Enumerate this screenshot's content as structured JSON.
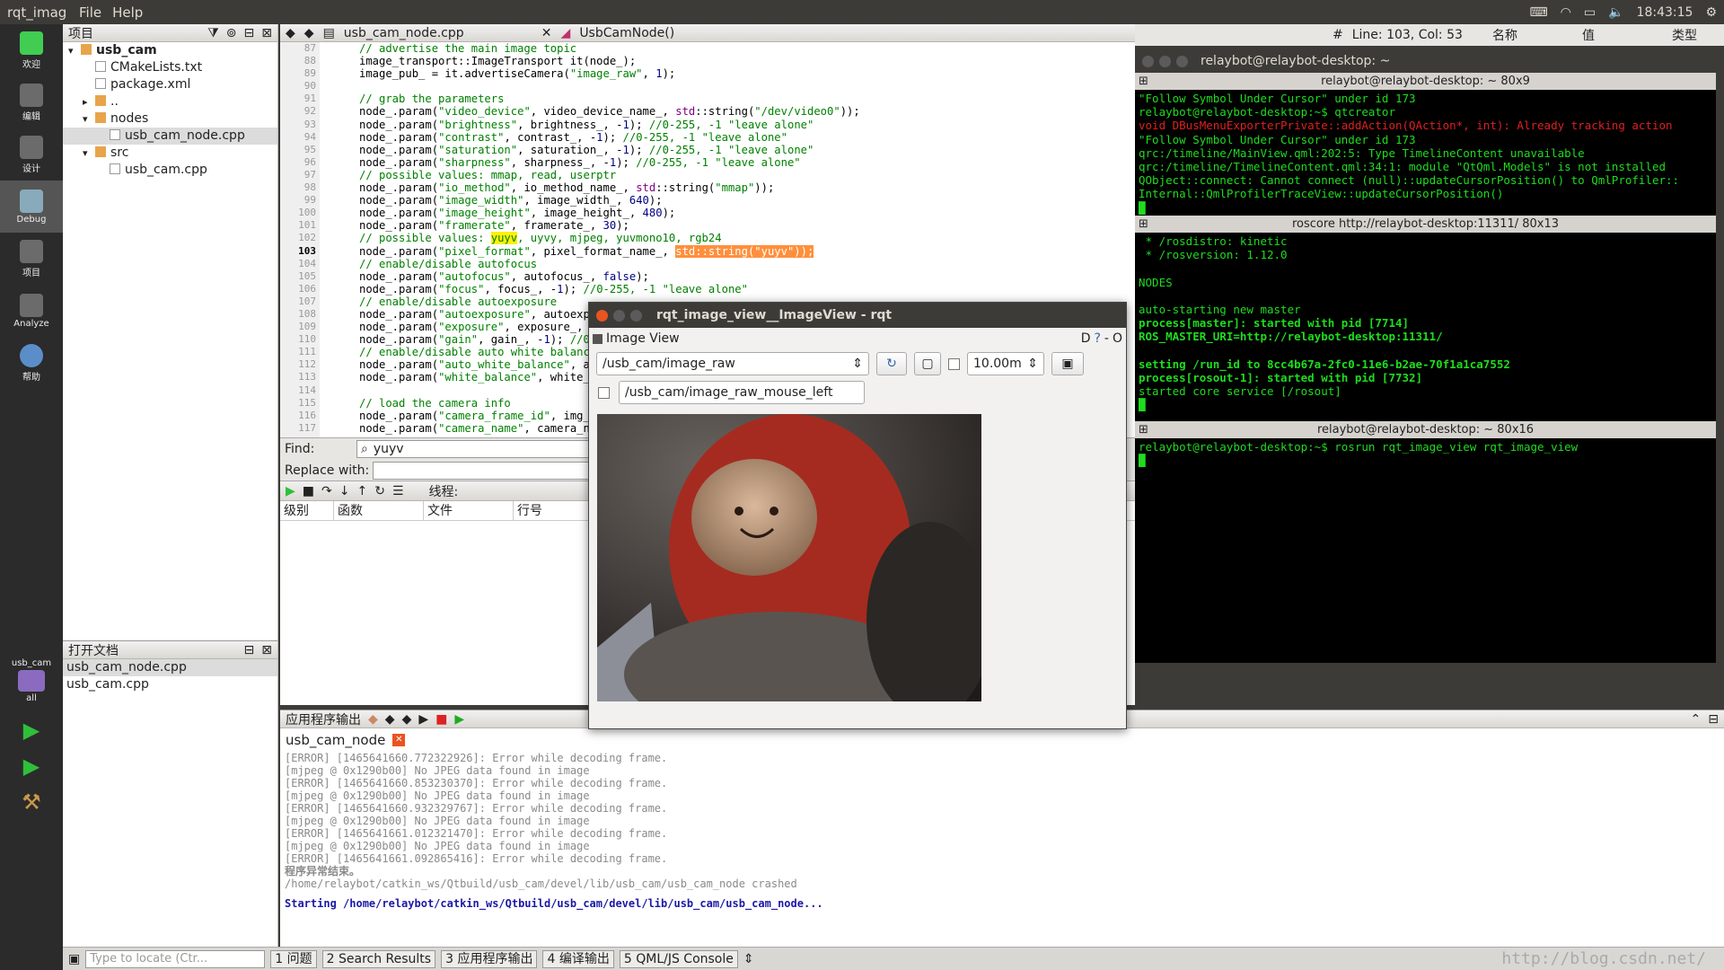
{
  "topbar": {
    "app_name": "rqt_imag",
    "menus": [
      "File",
      "Help"
    ],
    "clock": "18:43:15"
  },
  "modes": [
    {
      "label": "欢迎",
      "icon": "qt-logo-icon"
    },
    {
      "label": "编辑",
      "icon": "edit-icon"
    },
    {
      "label": "设计",
      "icon": "design-icon"
    },
    {
      "label": "Debug",
      "icon": "debug-icon"
    },
    {
      "label": "项目",
      "icon": "project-icon"
    },
    {
      "label": "Analyze",
      "icon": "analyze-icon"
    },
    {
      "label": "帮助",
      "icon": "help-icon"
    }
  ],
  "kit": {
    "project": "usb_cam",
    "config": "all"
  },
  "project_panel": {
    "title": "项目",
    "tree": [
      {
        "label": "usb_cam",
        "depth": 0,
        "kind": "project"
      },
      {
        "label": "CMakeLists.txt",
        "depth": 1,
        "kind": "file"
      },
      {
        "label": "package.xml",
        "depth": 1,
        "kind": "file"
      },
      {
        "label": "..",
        "depth": 1,
        "kind": "folder"
      },
      {
        "label": "nodes",
        "depth": 1,
        "kind": "folder"
      },
      {
        "label": "usb_cam_node.cpp",
        "depth": 2,
        "kind": "cpp",
        "selected": true
      },
      {
        "label": "src",
        "depth": 1,
        "kind": "folder"
      },
      {
        "label": "usb_cam.cpp",
        "depth": 2,
        "kind": "cpp"
      }
    ]
  },
  "open_docs": {
    "title": "打开文档",
    "items": [
      "usb_cam_node.cpp",
      "usb_cam.cpp"
    ]
  },
  "editor": {
    "filename": "usb_cam_node.cpp",
    "symbol": "UsbCamNode()",
    "position": "Line: 103, Col: 53",
    "line_numbers": [
      "87",
      "88",
      "89",
      "90",
      "91",
      "92",
      "93",
      "94",
      "95",
      "96",
      "97",
      "98",
      "99",
      "100",
      "101",
      "102",
      "103",
      "104",
      "105",
      "106",
      "107",
      "108",
      "109",
      "110",
      "111",
      "112",
      "113",
      "114",
      "115",
      "116",
      "117"
    ],
    "current_line": "103"
  },
  "find": {
    "find_label": "Find:",
    "find_value": "yuyv",
    "replace_label": "Replace with:"
  },
  "issues": {
    "thread_label": "线程:",
    "columns": [
      "级别",
      "函数",
      "文件",
      "行号"
    ]
  },
  "output": {
    "title": "应用程序输出",
    "tab": "usb_cam_node",
    "lines": [
      "[ERROR] [1465641660.772322926]: Error while decoding frame.",
      "[mjpeg @ 0x1290b00] No JPEG data found in image",
      "[ERROR] [1465641660.853230370]: Error while decoding frame.",
      "[mjpeg @ 0x1290b00] No JPEG data found in image",
      "[ERROR] [1465641660.932329767]: Error while decoding frame.",
      "[mjpeg @ 0x1290b00] No JPEG data found in image",
      "[ERROR] [1465641661.012321470]: Error while decoding frame.",
      "[mjpeg @ 0x1290b00] No JPEG data found in image",
      "[ERROR] [1465641661.092865416]: Error while decoding frame."
    ],
    "crash_title": "程序异常结束。",
    "crash_path": "/home/relaybot/catkin_ws/Qtbuild/usb_cam/devel/lib/usb_cam/usb_cam_node crashed",
    "starting": "Starting /home/relaybot/catkin_ws/Qtbuild/usb_cam/devel/lib/usb_cam/usb_cam_node..."
  },
  "statusbar": {
    "locator_placeholder": "Type to locate (Ctr...",
    "tabs": [
      {
        "num": "1",
        "label": "问题"
      },
      {
        "num": "2",
        "label": "Search Results"
      },
      {
        "num": "3",
        "label": "应用程序输出"
      },
      {
        "num": "4",
        "label": "编译输出"
      },
      {
        "num": "5",
        "label": "QML/JS Console"
      }
    ]
  },
  "props_header": [
    "名称",
    "值",
    "类型"
  ],
  "terminal": {
    "window_title": "relaybot@relaybot-desktop: ~",
    "panes": [
      {
        "label": "relaybot@relaybot-desktop: ~ 80x9"
      },
      {
        "label": "roscore http://relaybot-desktop:11311/ 80x13"
      },
      {
        "label": "relaybot@relaybot-desktop: ~ 80x16"
      }
    ]
  },
  "rqt": {
    "title": "rqt_image_view__ImageView - rqt",
    "plugin": "Image View",
    "topic": "/usb_cam/image_raw",
    "zoom": "10.00m",
    "mouse_topic": "/usb_cam/image_raw_mouse_left"
  },
  "watermark": "http://blog.csdn.net/"
}
